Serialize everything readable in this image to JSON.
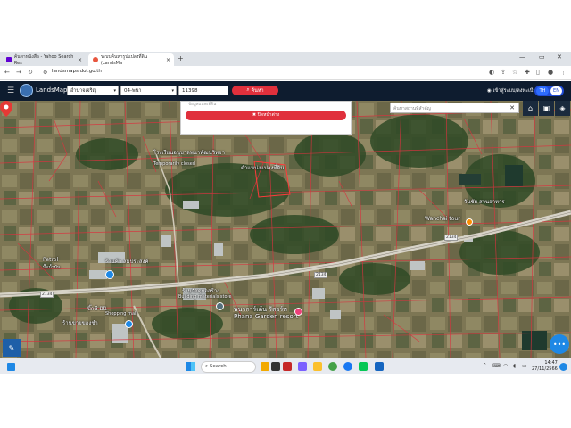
{
  "browser": {
    "tabs": [
      {
        "title": "ค้นหาหนังสือ - Yahoo Search Res"
      },
      {
        "title": "ระบบค้นหารูปแปลงที่ดิน (LandsMa"
      }
    ],
    "url": "landsmaps.dol.go.th"
  },
  "header": {
    "brand": "LandsMaps",
    "province": "อำนาจเจริญ",
    "district": "04-พนา",
    "parcel_no": "11398",
    "search_label": "ค้นหา",
    "login_label": "เข้าสู่ระบบ/ลงทะเบียน",
    "lang_th": "TH",
    "lang_en": "EN"
  },
  "map": {
    "popup_placeholder": "ข้อมูลแปลงที่ดิน",
    "popup_close": "ปิดหน้าต่าง",
    "search_placeholder": "ค้นหาสถานที่สำคัญ",
    "pin_label": "ตำแหน่งแปลงที่ดิน",
    "labels": {
      "school": "โรงเรียนอนุบาลพนาพัฒนวิทยา",
      "school_sub": "Temporarily closed",
      "wanchai_th": "วันชัย สวนอาหาร",
      "wanchai_en": "Wanchai tour",
      "petrol": "Petrol",
      "petrol_th": "ปั๊มน้ำมัน",
      "shop": "ร้านค้า สมประสงค์",
      "materials_th": "ร้านวัสดุก่อสร้าง",
      "materials_en": "Building materials store",
      "resort_th": "พนาการ์เด้น รีสอร์ท",
      "resort_en": "Phana Garden resort",
      "mall_th": "บิ๊กซี มินิ",
      "mall_en": "Shopping mall",
      "store_th": "ร้านขายของชำ",
      "road1": "2134",
      "road2": "2134",
      "road3": "2134"
    }
  },
  "taskbar": {
    "search": "Search",
    "time": "14:47",
    "date": "27/11/2566"
  },
  "colors": {
    "header_bg": "#0e1c2f",
    "accent_red": "#e0303c",
    "lang_blue": "#1f4bd6"
  }
}
